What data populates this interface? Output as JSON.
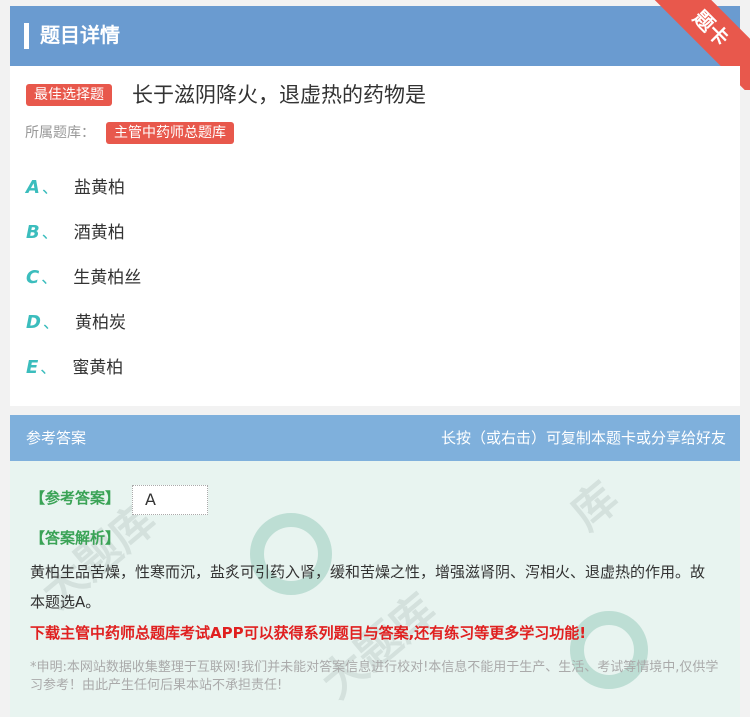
{
  "header": {
    "title": "题目详情",
    "ribbon": "题卡"
  },
  "question": {
    "type_tag": "最佳选择题",
    "title": "长于滋阴降火，退虚热的药物是",
    "source_label": "所属题库：",
    "source_tag": "主管中药师总题库"
  },
  "options": [
    {
      "letter": "A",
      "sep": "、",
      "text": "盐黄柏"
    },
    {
      "letter": "B",
      "sep": "、",
      "text": "酒黄柏"
    },
    {
      "letter": "C",
      "sep": "、",
      "text": "生黄柏丝"
    },
    {
      "letter": "D",
      "sep": "、",
      "text": "黄柏炭"
    },
    {
      "letter": "E",
      "sep": "、",
      "text": "蜜黄柏"
    }
  ],
  "answer_bar": {
    "left": "参考答案",
    "right": "长按（或右击）可复制本题卡或分享给好友"
  },
  "answer": {
    "answer_label": "【参考答案】",
    "answer_value": "A",
    "analysis_label": "【答案解析】",
    "analysis_text": "黄柏生品苦燥，性寒而沉，盐炙可引药入肾，缓和苦燥之性，增强滋肾阴、泻相火、退虚热的作用。故本题选A。",
    "promo": "下载主管中药师总题库考试APP可以获得系列题目与答案,还有练习等更多学习功能!",
    "disclaimer": "*申明:本网站数据收集整理于互联网!我们并未能对答案信息进行校对!本信息不能用于生产、生活、考试等情境中,仅供学习参考！由此产生任何后果本站不承担责任!"
  },
  "colors": {
    "header": "#6a9bd0",
    "tag": "#e8584c",
    "option_letter": "#3bbdbd",
    "answer_bar": "#7fb0dc",
    "promo": "#e02020"
  }
}
